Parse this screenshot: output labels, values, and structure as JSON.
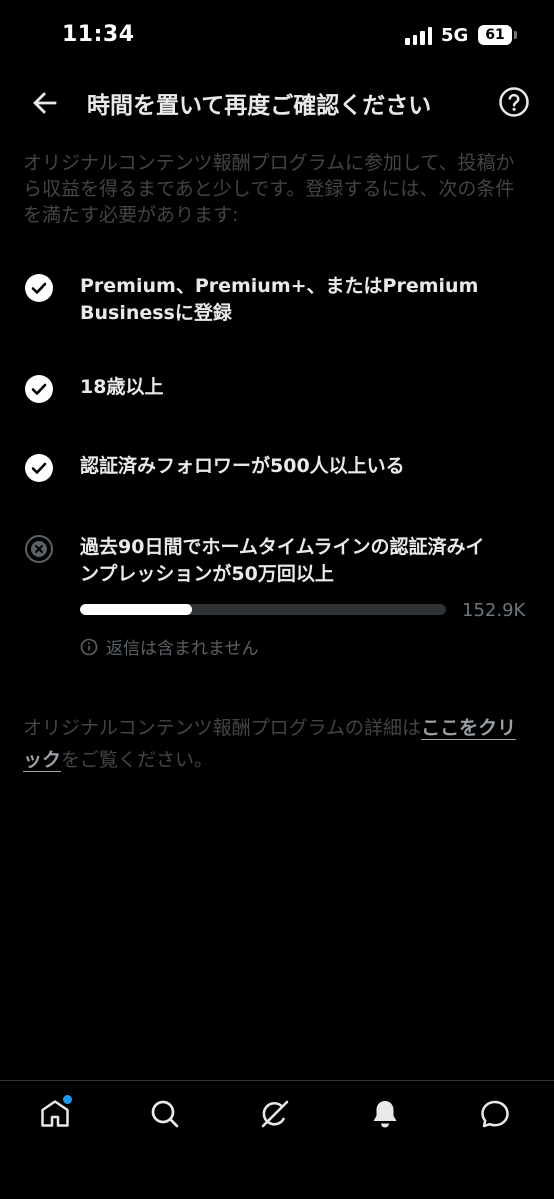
{
  "status_bar": {
    "time": "11:34",
    "network": "5G",
    "battery": "61"
  },
  "header": {
    "title": "時間を置いて再度ご確認ください"
  },
  "intro": "オリジナルコンテンツ報酬プログラムに参加して、投稿から収益を得るまであと少しです。登録するには、次の条件を満たす必要があります:",
  "requirements": [
    {
      "text": "Premium、Premium+、またはPremium Businessに登録",
      "status": "met",
      "icon": "check-circle-icon"
    },
    {
      "text": "18歳以上",
      "status": "met",
      "icon": "check-circle-icon"
    },
    {
      "text": "認証済みフォロワーが500人以上いる",
      "status": "met",
      "icon": "check-circle-icon"
    },
    {
      "text": "過去90日間でホームタイムラインの認証済みインプレッションが50万回以上",
      "status": "unmet",
      "icon": "x-circle-icon",
      "progress": {
        "fraction": 0.306,
        "value_label": "152.9K"
      },
      "note": "返信は含まれません"
    }
  ],
  "footer": {
    "text_before": "オリジナルコンテンツ報酬プログラムの詳細は",
    "link_text": "ここをクリック",
    "text_after": "をご覧ください。"
  },
  "bottom_nav": [
    {
      "name": "home",
      "icon": "home-icon",
      "badge": true
    },
    {
      "name": "search",
      "icon": "search-icon",
      "badge": false
    },
    {
      "name": "grok",
      "icon": "grok-icon",
      "badge": false
    },
    {
      "name": "notifications",
      "icon": "bell-icon",
      "badge": false
    },
    {
      "name": "messages",
      "icon": "chat-icon",
      "badge": false
    }
  ],
  "colors": {
    "background": "#000000",
    "accent": "#1d9bf0",
    "text": "#e7e9ea",
    "muted": "#444444"
  }
}
